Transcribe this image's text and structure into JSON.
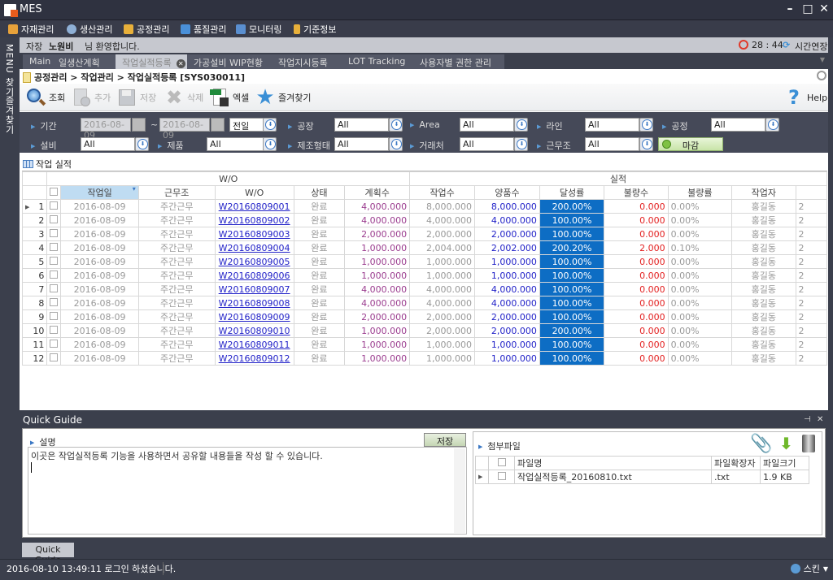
{
  "window": {
    "title": "MES"
  },
  "menu": [
    {
      "label": "자재관리",
      "icon": "box-icon",
      "color": "#e8a23a"
    },
    {
      "label": "생산관리",
      "icon": "clock-icon",
      "color": "#8fb0d6"
    },
    {
      "label": "공정관리",
      "icon": "worker-icon",
      "color": "#e8b03a"
    },
    {
      "label": "품질관리",
      "icon": "clipboard-icon",
      "color": "#4a90d9"
    },
    {
      "label": "모니터링",
      "icon": "monitor-icon",
      "color": "#5a8fd0"
    },
    {
      "label": "기준정보",
      "icon": "database-icon",
      "color": "#e8b03a"
    }
  ],
  "sidebar": {
    "menu_tab": "MENU 찾기",
    "favorites_tab": "즐겨찾기"
  },
  "welcome": {
    "role": "자장",
    "name": "노원비",
    "suffix": "님 환영합니다.",
    "timer": "28 : 44",
    "extend": "시간연장"
  },
  "tabs": [
    {
      "label": "Main"
    },
    {
      "label": "일생산계획"
    },
    {
      "label": "작업실적등록",
      "active": true
    },
    {
      "label": "가공설비 WIP현황"
    },
    {
      "label": "작업지시등록"
    },
    {
      "label": "LOT Tracking"
    },
    {
      "label": "사용자별 권한 관리"
    }
  ],
  "breadcrumb": "공정관리 > 작업관리 > 작업실적등록 [SYS030011]",
  "toolbar": {
    "search": "조회",
    "add": "추가",
    "save": "저장",
    "delete": "삭제",
    "excel": "엑셀",
    "favorite": "즐겨찾기",
    "help": "Help"
  },
  "filters": {
    "period_label": "기간",
    "date_from": "2016-08-09",
    "date_to": "2016-08-09",
    "tilde": "~",
    "day_select": "전일",
    "plant_label": "공장",
    "plant": "All",
    "area_label": "Area",
    "area": "All",
    "line_label": "라인",
    "line": "All",
    "process_label": "공정",
    "process": "All",
    "equip_label": "설비",
    "equip": "All",
    "product_label": "제품",
    "product": "All",
    "mfg_label": "제조형태",
    "mfg": "All",
    "vendor_label": "거래처",
    "vendor": "All",
    "shift_label": "근무조",
    "shift": "All",
    "close_button": "마감"
  },
  "grid": {
    "title": "작업 실적",
    "group_wo": "W/O",
    "group_result": "실적",
    "columns": [
      "작업일",
      "근무조",
      "W/O",
      "상태",
      "계획수",
      "작업수",
      "양품수",
      "달성률",
      "불량수",
      "불량률",
      "작업자"
    ],
    "rows": [
      {
        "no": "1",
        "date": "2016-08-09",
        "shift": "주간근무",
        "wo": "W20160809001",
        "status": "완료",
        "plan": "4,000.000",
        "work": "8,000.000",
        "good": "8,000.000",
        "rate": "200.00%",
        "defect": "0.000",
        "defect_rate": "0.00%",
        "worker": "홍길동",
        "extra": "2"
      },
      {
        "no": "2",
        "date": "2016-08-09",
        "shift": "주간근무",
        "wo": "W20160809002",
        "status": "완료",
        "plan": "4,000.000",
        "work": "4,000.000",
        "good": "4,000.000",
        "rate": "100.00%",
        "defect": "0.000",
        "defect_rate": "0.00%",
        "worker": "홍길동",
        "extra": "2"
      },
      {
        "no": "3",
        "date": "2016-08-09",
        "shift": "주간근무",
        "wo": "W20160809003",
        "status": "완료",
        "plan": "2,000.000",
        "work": "2,000.000",
        "good": "2,000.000",
        "rate": "100.00%",
        "defect": "0.000",
        "defect_rate": "0.00%",
        "worker": "홍길동",
        "extra": "2"
      },
      {
        "no": "4",
        "date": "2016-08-09",
        "shift": "주간근무",
        "wo": "W20160809004",
        "status": "완료",
        "plan": "1,000.000",
        "work": "2,004.000",
        "good": "2,002.000",
        "rate": "200.20%",
        "defect": "2.000",
        "defect_rate": "0.10%",
        "worker": "홍길동",
        "extra": "2"
      },
      {
        "no": "5",
        "date": "2016-08-09",
        "shift": "주간근무",
        "wo": "W20160809005",
        "status": "완료",
        "plan": "1,000.000",
        "work": "1,000.000",
        "good": "1,000.000",
        "rate": "100.00%",
        "defect": "0.000",
        "defect_rate": "0.00%",
        "worker": "홍길동",
        "extra": "2"
      },
      {
        "no": "6",
        "date": "2016-08-09",
        "shift": "주간근무",
        "wo": "W20160809006",
        "status": "완료",
        "plan": "1,000.000",
        "work": "1,000.000",
        "good": "1,000.000",
        "rate": "100.00%",
        "defect": "0.000",
        "defect_rate": "0.00%",
        "worker": "홍길동",
        "extra": "2"
      },
      {
        "no": "7",
        "date": "2016-08-09",
        "shift": "주간근무",
        "wo": "W20160809007",
        "status": "완료",
        "plan": "4,000.000",
        "work": "4,000.000",
        "good": "4,000.000",
        "rate": "100.00%",
        "defect": "0.000",
        "defect_rate": "0.00%",
        "worker": "홍길동",
        "extra": "2"
      },
      {
        "no": "8",
        "date": "2016-08-09",
        "shift": "주간근무",
        "wo": "W20160809008",
        "status": "완료",
        "plan": "4,000.000",
        "work": "4,000.000",
        "good": "4,000.000",
        "rate": "100.00%",
        "defect": "0.000",
        "defect_rate": "0.00%",
        "worker": "홍길동",
        "extra": "2"
      },
      {
        "no": "9",
        "date": "2016-08-09",
        "shift": "주간근무",
        "wo": "W20160809009",
        "status": "완료",
        "plan": "2,000.000",
        "work": "2,000.000",
        "good": "2,000.000",
        "rate": "100.00%",
        "defect": "0.000",
        "defect_rate": "0.00%",
        "worker": "홍길동",
        "extra": "2"
      },
      {
        "no": "10",
        "date": "2016-08-09",
        "shift": "주간근무",
        "wo": "W20160809010",
        "status": "완료",
        "plan": "1,000.000",
        "work": "2,000.000",
        "good": "2,000.000",
        "rate": "200.00%",
        "defect": "0.000",
        "defect_rate": "0.00%",
        "worker": "홍길동",
        "extra": "2"
      },
      {
        "no": "11",
        "date": "2016-08-09",
        "shift": "주간근무",
        "wo": "W20160809011",
        "status": "완료",
        "plan": "1,000.000",
        "work": "1,000.000",
        "good": "1,000.000",
        "rate": "100.00%",
        "defect": "0.000",
        "defect_rate": "0.00%",
        "worker": "홍길동",
        "extra": "2"
      },
      {
        "no": "12",
        "date": "2016-08-09",
        "shift": "주간근무",
        "wo": "W20160809012",
        "status": "완료",
        "plan": "1,000.000",
        "work": "1,000.000",
        "good": "1,000.000",
        "rate": "100.00%",
        "defect": "0.000",
        "defect_rate": "0.00%",
        "worker": "홍길동",
        "extra": "2"
      }
    ]
  },
  "quick_guide": {
    "title": "Quick Guide",
    "description_label": "설명",
    "save": "저장",
    "text": "이곳은 작업실적등록 기능을 사용하면서 공유할 내용들을 작성 할 수 있습니다.",
    "attachments_label": "첨부파일",
    "file_columns": [
      "파일명",
      "파일확장자",
      "파일크기"
    ],
    "files": [
      {
        "name": "작업실적등록_20160810.txt",
        "ext": ".txt",
        "size": "1.9 KB"
      }
    ],
    "tab_label": "Quick Guide"
  },
  "status": {
    "message": "2016-08-10 13:49:11 로그인 하셨습니다.",
    "skin": "스킨"
  },
  "colors": {
    "accent": "#0d6dc4",
    "plan": "#9b3d8f",
    "good": "#2222c8",
    "defect": "#e32020"
  }
}
